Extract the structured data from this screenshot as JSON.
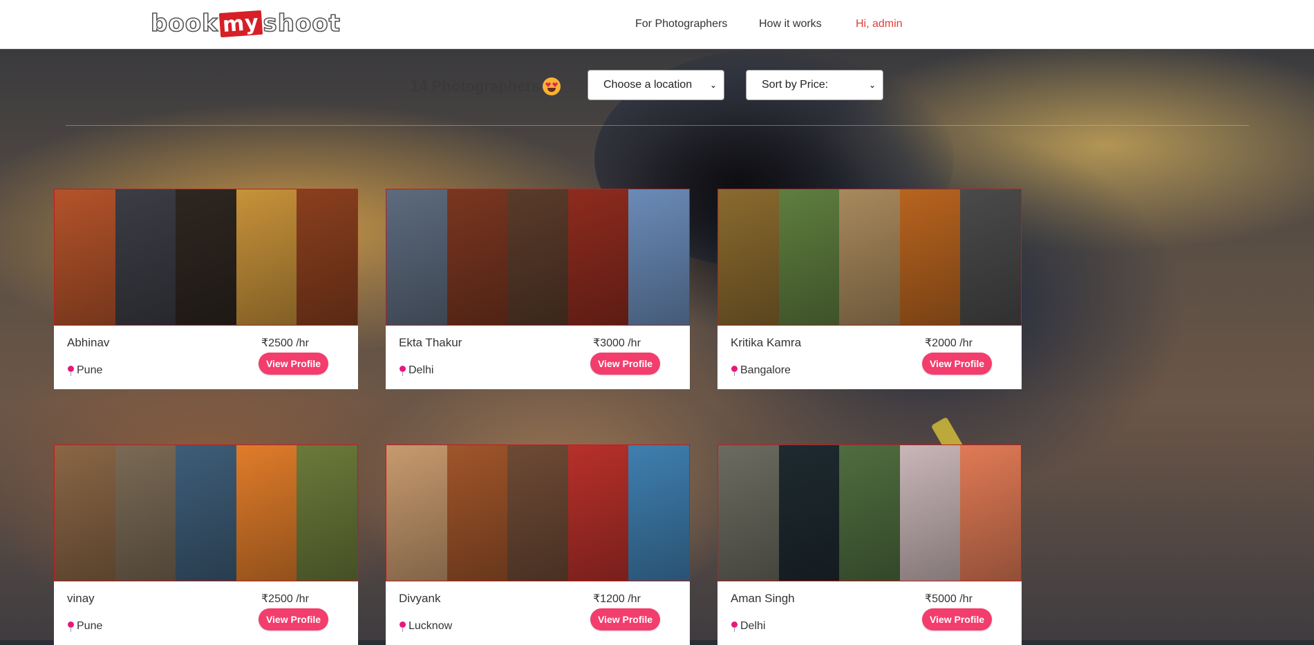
{
  "nav": {
    "logo": {
      "part1": "book",
      "part2": "my",
      "part3": "shoot"
    },
    "links": [
      {
        "label": "For Photographers"
      },
      {
        "label": "How it works"
      }
    ],
    "user_label": "Hi, admin"
  },
  "filters": {
    "count_text": "14 Photographers",
    "location_select": "Choose a location",
    "sort_select": "Sort by Price:"
  },
  "photographers": [
    {
      "name": "Abhinav",
      "price": "₹2500 /hr",
      "location": "Pune",
      "button": "View Profile",
      "tiles": [
        "#b4532a",
        "#3c3d45",
        "#2e2620",
        "#c7923a",
        "#8a3f1e"
      ]
    },
    {
      "name": "Ekta Thakur",
      "price": "₹3000 /hr",
      "location": "Delhi",
      "button": "View Profile",
      "tiles": [
        "#5d6b7e",
        "#7a3620",
        "#5a3b2a",
        "#8e2b1e",
        "#6a8bb8"
      ]
    },
    {
      "name": "Kritika Kamra",
      "price": "₹2000 /hr",
      "location": "Bangalore",
      "button": "View Profile",
      "tiles": [
        "#8a6a2e",
        "#5f7e3f",
        "#a8895c",
        "#b8641f",
        "#4a4a4a"
      ]
    },
    {
      "name": "vinay",
      "price": "₹2500 /hr",
      "location": "Pune",
      "button": "View Profile",
      "tiles": [
        "#8a6645",
        "#7a6a55",
        "#3e5d78",
        "#e07c2a",
        "#6b7a3a"
      ]
    },
    {
      "name": "Divyank",
      "price": "₹1200 /hr",
      "location": "Lucknow",
      "button": "View Profile",
      "tiles": [
        "#c79a6e",
        "#a0552a",
        "#6e4a35",
        "#b8302a",
        "#3f7fb0"
      ]
    },
    {
      "name": "Aman Singh",
      "price": "₹5000 /hr",
      "location": "Delhi",
      "button": "View Profile",
      "tiles": [
        "#6b6b60",
        "#1e2a30",
        "#4f6d3f",
        "#c9b6b8",
        "#e07a55"
      ]
    }
  ]
}
